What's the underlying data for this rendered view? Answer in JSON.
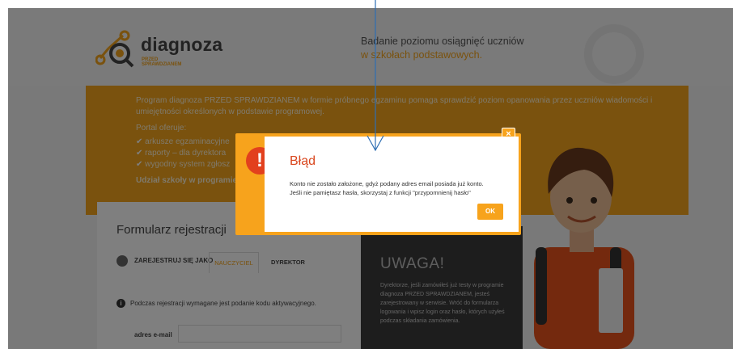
{
  "header": {
    "logo_text": "diagnoza",
    "logo_sub": [
      "PRZED",
      "SPRAWDZIANEM"
    ],
    "tagline_line1": "Badanie poziomu osiągnięć uczniów",
    "tagline_line2": "w szkołach podstawowych."
  },
  "promo": {
    "paragraph": "Program diagnoza PRZED SPRAWDZIANEM w formie próbnego egzaminu pomaga sprawdzić poziom opanowania przez uczniów wiadomości i umiejętności określonych w podstawie programowej.",
    "offers_label": "Portal oferuje:",
    "items": [
      "arkusze egzaminacyjne",
      "raporty – dla dyrektora",
      "wygodny system zgłosz"
    ],
    "participation": "Udział szkoły w programie"
  },
  "form": {
    "title": "Formularz rejestracji",
    "register_as_label": "ZAREJESTRUJ SIĘ JAKO",
    "tab_teacher": "NAUCZYCIEL",
    "tab_director": "DYREKTOR",
    "info_icon": "i",
    "info_text": "Podczas rejestracji wymagane jest podanie kodu aktywacyjnego.",
    "email_label": "adres e-mail",
    "email_value": ""
  },
  "notice": {
    "title": "UWAGA!",
    "text": "Dyrektorze, jeśli zamówiłeś już testy w programie diagnoza PRZED SPRAWDZIANEM, jesteś zarejestrowany w serwisie. Wróć do formularza logowania i wpisz login oraz hasło, których użyłeś podczas składania zamówienia."
  },
  "modal": {
    "title": "Błąd",
    "alert_symbol": "!",
    "message_line1": "Konto nie zostało założone, gdyż podany adres email posiada już konto.",
    "message_line2": "Jeśli nie pamiętasz hasła, skorzystaj z funkcji \"przypomnienij hasło\"",
    "ok_label": "OK",
    "close_symbol": "×"
  },
  "colors": {
    "accent": "#f7a31c",
    "error": "#d9451c",
    "overlay": "rgba(0,0,0,0.5)",
    "arrow": "#2f6fb3"
  },
  "icons": [
    "logo-icon",
    "user-icon",
    "info-icon",
    "alert-icon",
    "close-icon",
    "down-arrow-icon"
  ]
}
